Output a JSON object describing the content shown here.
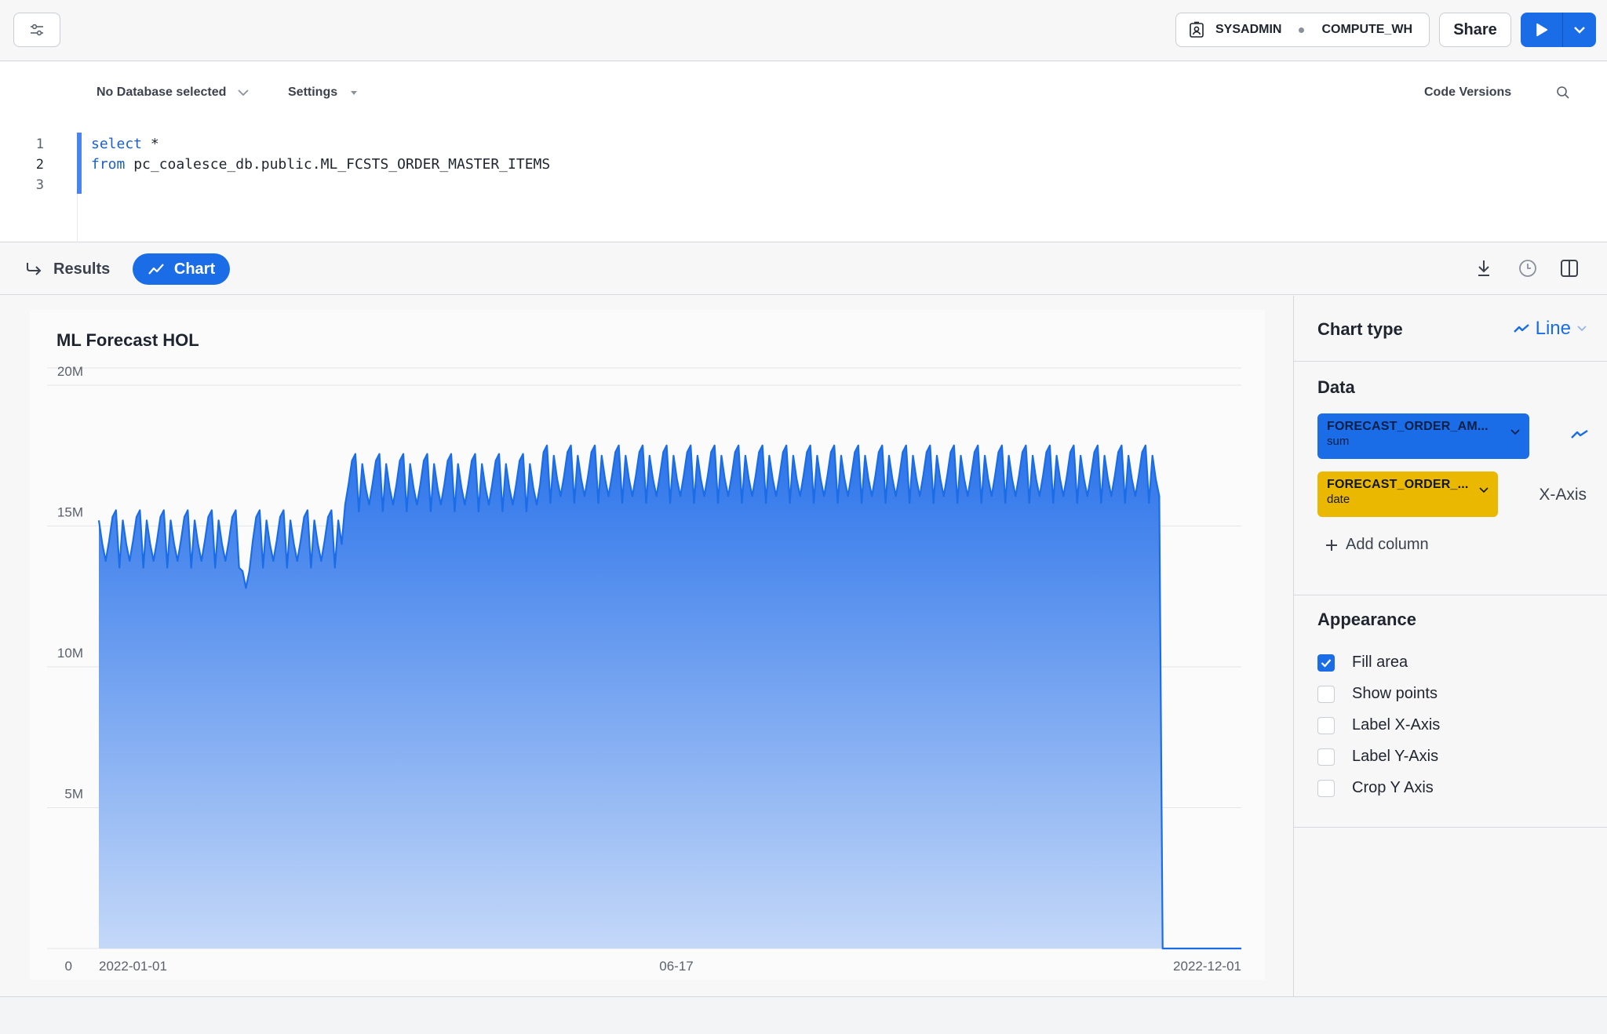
{
  "topbar": {
    "role": "SYSADMIN",
    "warehouse": "COMPUTE_WH",
    "share_label": "Share"
  },
  "editor": {
    "database_selector": "No Database selected",
    "settings_label": "Settings",
    "code_versions_label": "Code Versions",
    "line_numbers": [
      "1",
      "2",
      "3"
    ],
    "line1_keyword": "select",
    "line1_rest": " *",
    "line2_keyword": "from",
    "line2_rest": " pc_coalesce_db.public.ML_FCSTS_ORDER_MASTER_ITEMS"
  },
  "tabs": {
    "results_label": "Results",
    "chart_label": "Chart"
  },
  "colors": {
    "accent": "#1a6ce7",
    "yellow_column": "#ebb800"
  },
  "chart_data": {
    "type": "area",
    "title": "ML Forecast HOL",
    "x_ticks": [
      "2022-01-01",
      "06-17",
      "2022-12-01"
    ],
    "y_ticks": [
      {
        "label": "0",
        "value": 0
      },
      {
        "label": "5M",
        "value": 5000000
      },
      {
        "label": "10M",
        "value": 10000000
      },
      {
        "label": "15M",
        "value": 15000000
      },
      {
        "label": "20M",
        "value": 20000000
      }
    ],
    "ylim": [
      0,
      20000000
    ],
    "xlim": [
      "2022-01-01",
      "2022-12-01"
    ],
    "grid": true,
    "fill_area": true,
    "series": [
      {
        "x_start": "2022-01-01",
        "x_step_days": 1,
        "weekly_pattern_M": [
          15.2,
          14.5,
          14.0,
          14.6,
          15.3,
          15.5,
          13.8
        ],
        "segments": [
          {
            "from": "2022-01-01",
            "to": "2022-03-13",
            "base_M": 14.6,
            "dip": {
              "on": "2022-02-13",
              "value_M": 12.8
            }
          },
          {
            "from": "2022-03-14",
            "to": "2022-05-10",
            "base_M": 16.6
          },
          {
            "from": "2022-05-11",
            "to": "2022-11-07",
            "base_M": 16.9
          },
          {
            "from": "2022-11-08",
            "to": "2022-12-01",
            "value_M": 0
          }
        ]
      }
    ]
  },
  "panel": {
    "chart_type_label": "Chart type",
    "chart_type_value": "Line",
    "data_heading": "Data",
    "y_column": {
      "name": "FORECAST_ORDER_AM...",
      "aggregation": "sum"
    },
    "x_column": {
      "name": "FORECAST_ORDER_...",
      "aggregation": "date"
    },
    "x_axis_label": "X-Axis",
    "add_column_label": "Add column",
    "appearance_heading": "Appearance",
    "options": [
      {
        "label": "Fill area",
        "checked": true
      },
      {
        "label": "Show points",
        "checked": false
      },
      {
        "label": "Label X-Axis",
        "checked": false
      },
      {
        "label": "Label Y-Axis",
        "checked": false
      },
      {
        "label": "Crop Y Axis",
        "checked": false
      }
    ]
  }
}
